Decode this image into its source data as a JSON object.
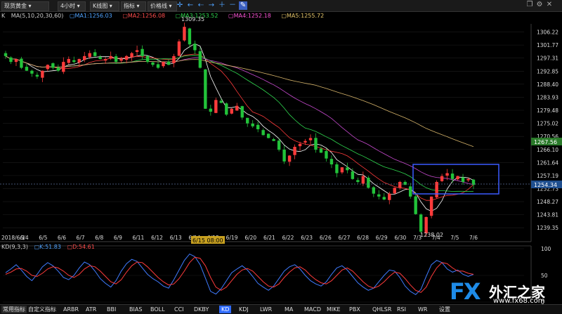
{
  "toolbar": {
    "symbol": "现货黄金",
    "period": "4小时",
    "chart_kind": "K线图",
    "indicator": "指标",
    "price_line": "价格线",
    "icons": [
      "crosshair-icon",
      "arrow-left-icon",
      "arrow-left-alt-icon",
      "arrow-right-icon",
      "zoom-in-icon",
      "zoom-out-icon",
      "pen-icon"
    ]
  },
  "ma_legend": {
    "k_label": "K",
    "params": "MA(5,10,20,30,60)",
    "ma1": "MA1:1256.03",
    "ma2": "MA2:1256.08",
    "ma3": "MA3:1253.52",
    "ma4": "MA4:1252.18",
    "ma5": "MA5:1255.72"
  },
  "kd_legend": {
    "params": "KD(9,3,3)",
    "k": "K:51.83",
    "d": "D:54.61"
  },
  "colors": {
    "up": "#ff3b3b",
    "down": "#22c33a",
    "ma1": "#ffffff",
    "ma2": "#ffe55a",
    "ma3": "#c84ad0",
    "ma4": "#2fd84f",
    "ma5": "#e0e0e0",
    "k_line": "#3f7bff",
    "d_line": "#ff3b3b",
    "box": "#3a5bff",
    "last_price_bg": "#2a7a2a",
    "current_price_bg": "#1f4f8f"
  },
  "chart_data": {
    "type": "candlestick",
    "y_ticks": [
      "1306.22",
      "1301.77",
      "1297.31",
      "1292.85",
      "1288.40",
      "1283.93",
      "1279.48",
      "1275.02",
      "1270.56",
      "1266.10",
      "1261.64",
      "1257.19",
      "1252.73",
      "1248.27",
      "1243.81",
      "1239.35"
    ],
    "ylim": [
      1237,
      1309
    ],
    "x_ticks": [
      "2018/6/1",
      "6/4",
      "6/5",
      "6/6",
      "6/7",
      "6/8",
      "6/9",
      "6/11",
      "6/12",
      "6/13",
      "6/14",
      "6/15",
      "6/19",
      "6/20",
      "6/21",
      "6/22",
      "6/23",
      "6/26",
      "6/27",
      "6/28",
      "6/29",
      "6/30",
      "7/3",
      "7/4",
      "7/5",
      "7/6"
    ],
    "crosshair_date": "6/15 08:00",
    "price_labels": {
      "high": "1309.35",
      "low": "1238.02",
      "last": "1267.56",
      "current": "1254.34"
    },
    "kd_ticks": [
      "100",
      "50",
      "0"
    ],
    "candles_close": [
      1298,
      1296,
      1297,
      1294,
      1293,
      1292,
      1291,
      1293,
      1295,
      1294,
      1293,
      1296,
      1297,
      1296,
      1297,
      1298,
      1299,
      1298,
      1297,
      1297,
      1298,
      1296,
      1297,
      1298,
      1299,
      1300,
      1298,
      1296,
      1295,
      1294,
      1296,
      1295,
      1298,
      1303,
      1308,
      1302,
      1300,
      1294,
      1280,
      1279,
      1283,
      1282,
      1278,
      1280,
      1281,
      1277,
      1275,
      1274,
      1273,
      1271,
      1270,
      1269,
      1266,
      1262,
      1264,
      1267,
      1268,
      1269,
      1270,
      1266,
      1265,
      1263,
      1261,
      1258,
      1260,
      1259,
      1256,
      1255,
      1257,
      1253,
      1251,
      1250,
      1249,
      1251,
      1253,
      1255,
      1254,
      1250,
      1244,
      1238,
      1243,
      1250,
      1255,
      1257,
      1258,
      1256,
      1257,
      1255,
      1256,
      1254
    ],
    "k_values": [
      55,
      62,
      70,
      60,
      48,
      40,
      52,
      66,
      74,
      68,
      58,
      46,
      42,
      50,
      64,
      75,
      70,
      58,
      44,
      35,
      28,
      40,
      58,
      72,
      80,
      76,
      64,
      52,
      44,
      38,
      30,
      26,
      42,
      60,
      78,
      90,
      85,
      70,
      45,
      20,
      15,
      25,
      40,
      55,
      62,
      68,
      60,
      48,
      35,
      28,
      22,
      30,
      44,
      58,
      66,
      70,
      62,
      50,
      40,
      34,
      30,
      38,
      52,
      64,
      68,
      60,
      48,
      36,
      28,
      22,
      26,
      38,
      50,
      60,
      58,
      46,
      30,
      20,
      14,
      24,
      48,
      70,
      78,
      74,
      62,
      56,
      60,
      52,
      48,
      52
    ],
    "d_values": [
      52,
      56,
      62,
      63,
      58,
      50,
      48,
      54,
      62,
      66,
      64,
      58,
      50,
      46,
      52,
      62,
      68,
      66,
      58,
      48,
      38,
      34,
      42,
      56,
      68,
      75,
      74,
      66,
      56,
      46,
      38,
      32,
      34,
      44,
      58,
      74,
      84,
      82,
      68,
      46,
      28,
      22,
      28,
      40,
      52,
      60,
      63,
      58,
      48,
      38,
      30,
      28,
      34,
      46,
      56,
      64,
      66,
      60,
      50,
      42,
      36,
      34,
      40,
      50,
      60,
      64,
      58,
      48,
      38,
      30,
      26,
      30,
      38,
      48,
      56,
      54,
      44,
      32,
      22,
      18,
      28,
      48,
      64,
      74,
      72,
      64,
      58,
      58,
      54,
      52
    ]
  },
  "bottom_tabs": [
    "常用指标",
    "自定义指标",
    "ARBR",
    "ATR",
    "BBI",
    "BIAS",
    "BOLL",
    "CCI",
    "DKBY",
    "KD",
    "KDJ",
    "LWR",
    "MA",
    "MACD",
    "MIKE",
    "PBX",
    "QHLSR",
    "RSI",
    "WR",
    "设置"
  ],
  "logo": {
    "fx": "FX",
    "cn": "外汇之家",
    "url": "www.fx68.com"
  }
}
